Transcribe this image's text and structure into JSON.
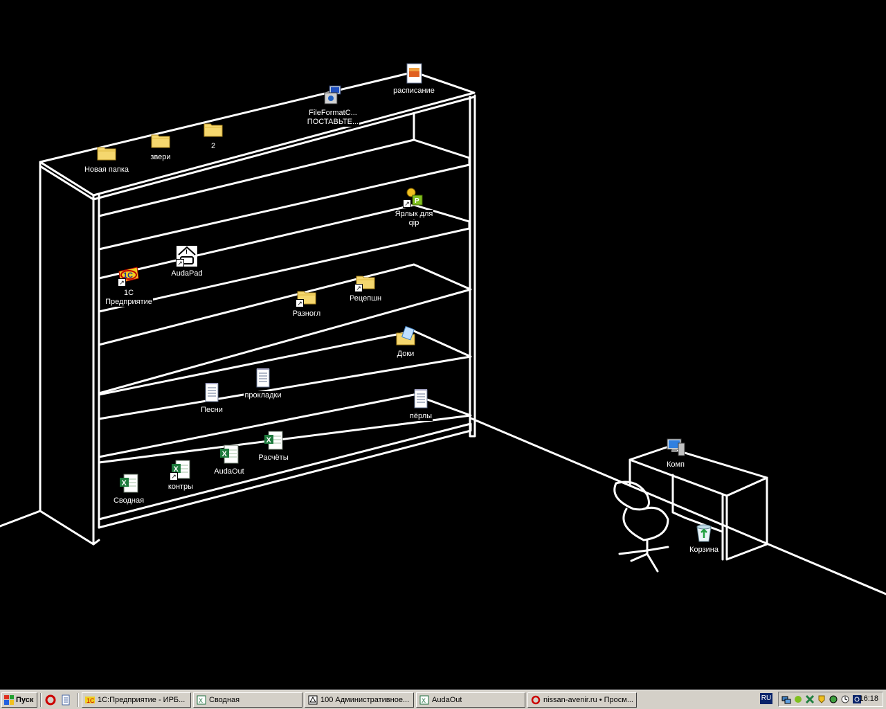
{
  "desktop": {
    "icons": [
      {
        "name": "schedule-icon",
        "label": "расписание",
        "type": "image",
        "shortcut": false
      },
      {
        "name": "fileformat-icon",
        "label": "FileFormatC...\nПОСТАВЬТЕ...",
        "type": "setup",
        "shortcut": false
      },
      {
        "name": "new-folder-icon",
        "label": "Новая папка",
        "type": "folder",
        "shortcut": false
      },
      {
        "name": "animals-folder-icon",
        "label": "звери",
        "type": "folder",
        "shortcut": false
      },
      {
        "name": "folder-2-icon",
        "label": "2",
        "type": "folder",
        "shortcut": false
      },
      {
        "name": "qip-shortcut-icon",
        "label": "Ярлык для\nqip",
        "type": "qip",
        "shortcut": true
      },
      {
        "name": "audapad-icon",
        "label": "AudaPad",
        "type": "audapad",
        "shortcut": true
      },
      {
        "name": "1c-enterprise-icon",
        "label": "1С\nПредприятие",
        "type": "1c",
        "shortcut": true
      },
      {
        "name": "raznogl-folder-icon",
        "label": "Разногл",
        "type": "folder",
        "shortcut": true
      },
      {
        "name": "reception-folder-icon",
        "label": "Рецепшн",
        "type": "folder",
        "shortcut": true
      },
      {
        "name": "docs-folder-icon",
        "label": "Доки",
        "type": "docs",
        "shortcut": false
      },
      {
        "name": "gaskets-doc-icon",
        "label": "прокладки",
        "type": "text",
        "shortcut": false
      },
      {
        "name": "songs-doc-icon",
        "label": "Песни",
        "type": "text",
        "shortcut": false
      },
      {
        "name": "pearls-doc-icon",
        "label": "пёрлы",
        "type": "text",
        "shortcut": false
      },
      {
        "name": "calculations-excel-icon",
        "label": "Расчёты",
        "type": "excel",
        "shortcut": false
      },
      {
        "name": "audaout-excel-icon",
        "label": "AudaOut",
        "type": "excel",
        "shortcut": false
      },
      {
        "name": "contracts-excel-icon",
        "label": "контры",
        "type": "excel",
        "shortcut": true
      },
      {
        "name": "summary-excel-icon",
        "label": "Сводная",
        "type": "excel",
        "shortcut": false
      },
      {
        "name": "my-computer-icon",
        "label": "Комп",
        "type": "computer",
        "shortcut": false
      },
      {
        "name": "recycle-bin-icon",
        "label": "Корзина",
        "type": "recycle",
        "shortcut": false
      }
    ]
  },
  "taskbar": {
    "start_label": "Пуск",
    "tasks": [
      {
        "label": "1С:Предприятие - ИРБ..."
      },
      {
        "label": "Сводная"
      },
      {
        "label": "100 Административное..."
      },
      {
        "label": "AudaOut"
      },
      {
        "label": "nissan-avenir.ru • Просм..."
      }
    ],
    "language": "RU",
    "clock": "16:18"
  },
  "colors": {
    "desktop_background": "#000000",
    "wallpaper_line": "#ffffff",
    "taskbar": "#d4d0c8"
  }
}
